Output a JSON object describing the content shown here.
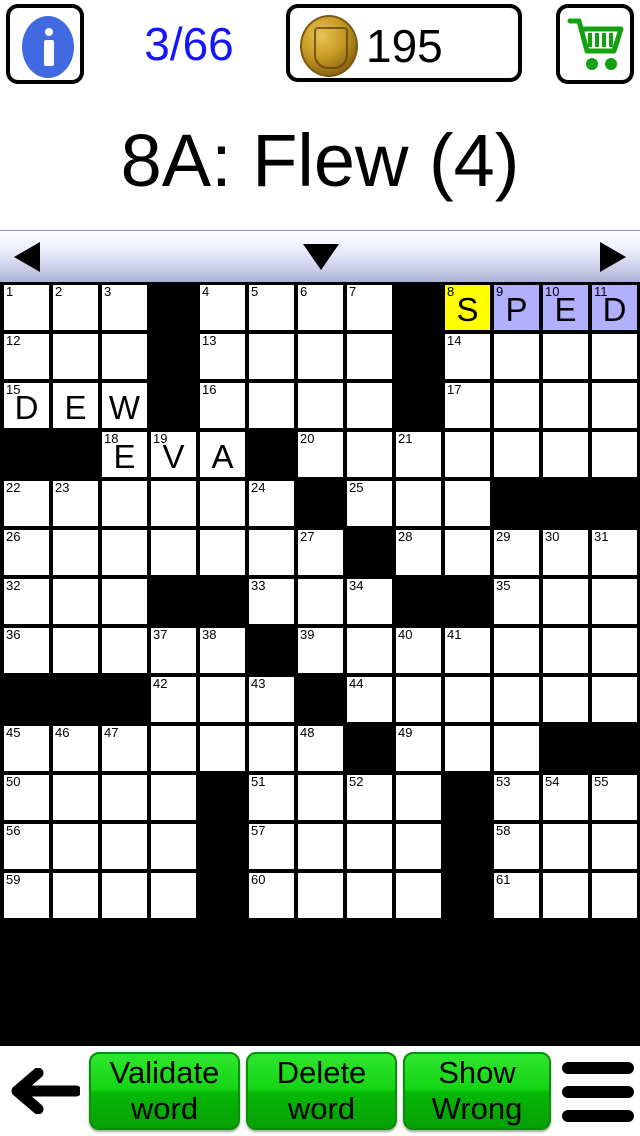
{
  "header": {
    "info_icon": "info-icon",
    "progress": "3/66",
    "coin_icon": "gold-coin-icon",
    "coins": "195",
    "shop_icon": "shopping-cart-icon"
  },
  "clue": {
    "text": "8A: Flew (4)"
  },
  "nav": {
    "prev_icon": "left-triangle-icon",
    "direction_icon": "down-triangle-icon",
    "next_icon": "right-triangle-icon"
  },
  "footer": {
    "back_icon": "left-arrow-icon",
    "validate_line1": "Validate",
    "validate_line2": "word",
    "delete_line1": "Delete",
    "delete_line2": "word",
    "showwrong_line1": "Show",
    "showwrong_line2": "Wrong",
    "menu_icon": "hamburger-menu-icon"
  },
  "colors": {
    "selected_cell": "#ffff00",
    "highlight_word": "#b0b0ff",
    "progress_text": "#1414ff",
    "button_green": "#14d414",
    "block": "#000000"
  },
  "grid": {
    "cols": 13,
    "rows": 13,
    "cells": [
      [
        {
          "n": "1"
        },
        {
          "n": "2"
        },
        {
          "n": "3"
        },
        {
          "b": true
        },
        {
          "n": "4"
        },
        {
          "n": "5"
        },
        {
          "n": "6"
        },
        {
          "n": "7"
        },
        {
          "b": true
        },
        {
          "n": "8",
          "l": "S",
          "s": "sel"
        },
        {
          "n": "9",
          "l": "P",
          "s": "hl"
        },
        {
          "n": "10",
          "l": "E",
          "s": "hl"
        },
        {
          "n": "11",
          "l": "D",
          "s": "hl"
        }
      ],
      [
        {
          "n": "12"
        },
        {},
        {},
        {
          "b": true
        },
        {
          "n": "13"
        },
        {},
        {},
        {},
        {
          "b": true
        },
        {
          "n": "14"
        },
        {},
        {},
        {}
      ],
      [
        {
          "n": "15",
          "l": "D"
        },
        {
          "l": "E"
        },
        {
          "l": "W"
        },
        {
          "b": true
        },
        {
          "n": "16"
        },
        {},
        {},
        {},
        {
          "b": true
        },
        {
          "n": "17"
        },
        {},
        {},
        {}
      ],
      [
        {
          "b": true
        },
        {
          "b": true
        },
        {
          "n": "18",
          "l": "E"
        },
        {
          "n": "19",
          "l": "V"
        },
        {
          "l": "A"
        },
        {
          "b": true
        },
        {
          "n": "20"
        },
        {},
        {
          "n": "21"
        },
        {},
        {},
        {},
        {}
      ],
      [
        {
          "n": "22"
        },
        {
          "n": "23"
        },
        {},
        {},
        {},
        {
          "n": "24"
        },
        {
          "b": true
        },
        {
          "n": "25"
        },
        {},
        {},
        {
          "b": true
        },
        {
          "b": true
        },
        {
          "b": true
        }
      ],
      [
        {
          "n": "26"
        },
        {},
        {},
        {},
        {},
        {},
        {
          "n": "27"
        },
        {
          "b": true
        },
        {
          "n": "28"
        },
        {},
        {
          "n": "29"
        },
        {
          "n": "30"
        },
        {
          "n": "31"
        }
      ],
      [
        {
          "n": "32"
        },
        {},
        {},
        {
          "b": true
        },
        {
          "b": true
        },
        {
          "n": "33"
        },
        {},
        {
          "n": "34"
        },
        {
          "b": true
        },
        {
          "b": true
        },
        {
          "n": "35"
        },
        {},
        {}
      ],
      [
        {
          "n": "36"
        },
        {},
        {},
        {
          "n": "37"
        },
        {
          "n": "38"
        },
        {
          "b": true
        },
        {
          "n": "39"
        },
        {},
        {
          "n": "40"
        },
        {
          "n": "41"
        },
        {},
        {},
        {}
      ],
      [
        {
          "b": true
        },
        {
          "b": true
        },
        {
          "b": true
        },
        {
          "n": "42"
        },
        {},
        {
          "n": "43"
        },
        {
          "b": true
        },
        {
          "n": "44"
        },
        {},
        {},
        {},
        {},
        {}
      ],
      [
        {
          "n": "45"
        },
        {
          "n": "46"
        },
        {
          "n": "47"
        },
        {},
        {},
        {},
        {
          "n": "48"
        },
        {
          "b": true
        },
        {
          "n": "49"
        },
        {},
        {},
        {
          "b": true
        },
        {
          "b": true
        }
      ],
      [
        {
          "n": "50"
        },
        {},
        {},
        {},
        {
          "b": true
        },
        {
          "n": "51"
        },
        {},
        {
          "n": "52"
        },
        {},
        {
          "b": true
        },
        {
          "n": "53"
        },
        {
          "n": "54"
        },
        {
          "n": "55"
        }
      ],
      [
        {
          "n": "56"
        },
        {},
        {},
        {},
        {
          "b": true
        },
        {
          "n": "57"
        },
        {},
        {},
        {},
        {
          "b": true
        },
        {
          "n": "58"
        },
        {},
        {}
      ],
      [
        {
          "n": "59"
        },
        {},
        {},
        {},
        {
          "b": true
        },
        {
          "n": "60"
        },
        {},
        {},
        {},
        {
          "b": true
        },
        {
          "n": "61"
        },
        {},
        {}
      ]
    ]
  }
}
